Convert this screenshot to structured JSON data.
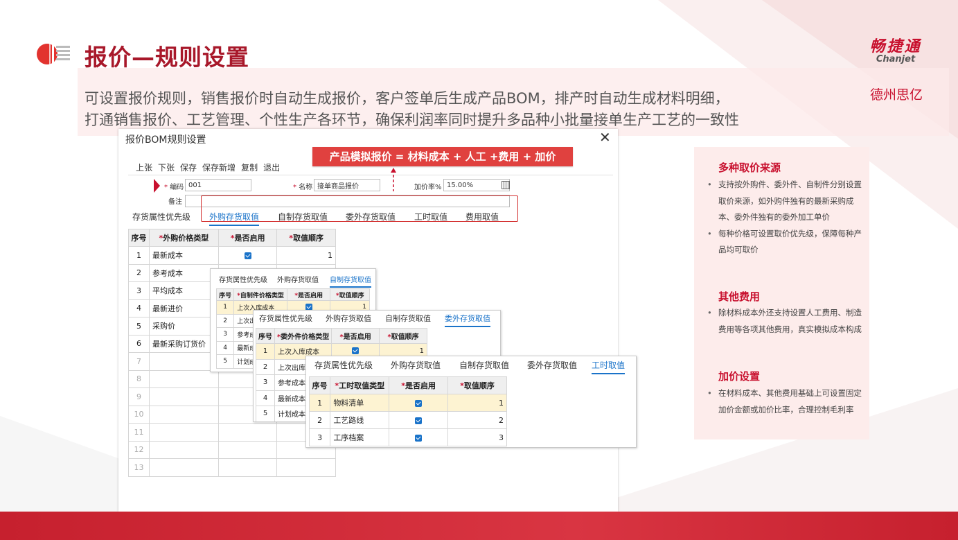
{
  "slide": {
    "title": "报价—规则设置",
    "brand_cn": "畅捷通",
    "brand_en": "Chanjet",
    "company": "德州思亿",
    "desc_line1": "可设置报价规则，销售报价时自动生成报价，客户签单后生成产品BOM，排产时自动生成材料明细，",
    "desc_line2": "打通销售报价、工艺管理、个性生产各环节，确保利润率同时提升多品种小批量接单生产工艺的一致性",
    "formula": "产品模拟报价 = 材料成本 + 人工 +费用 + 加价"
  },
  "window": {
    "title": "报价BOM规则设置",
    "close": "✕",
    "toolbar": [
      "上张",
      "下张",
      "保存",
      "保存新增",
      "复制",
      "退出"
    ],
    "form": {
      "code_label": "编码",
      "code_value": "001",
      "name_label": "名称",
      "name_value": "接单商品报价",
      "markup_label": "加价率%",
      "markup_value": "15.00%",
      "remark_label": "备注",
      "remark_value": ""
    },
    "tabs": [
      "存货属性优先级",
      "外购存货取值",
      "自制存货取值",
      "委外存货取值",
      "工时取值",
      "费用取值"
    ],
    "active_tab": "外购存货取值",
    "table": {
      "headers": [
        "序号",
        "外购价格类型",
        "是否启用",
        "取值顺序"
      ],
      "rows": [
        [
          "1",
          "最新成本",
          true,
          "1"
        ],
        [
          "2",
          "参考成本",
          null,
          ""
        ],
        [
          "3",
          "平均成本",
          null,
          ""
        ],
        [
          "4",
          "最新进价",
          null,
          ""
        ],
        [
          "5",
          "采购价",
          null,
          ""
        ],
        [
          "6",
          "最新采购订货价",
          null,
          ""
        ],
        [
          "7",
          "",
          null,
          ""
        ],
        [
          "8",
          "",
          null,
          ""
        ],
        [
          "9",
          "",
          null,
          ""
        ],
        [
          "10",
          "",
          null,
          ""
        ],
        [
          "11",
          "",
          null,
          ""
        ],
        [
          "12",
          "",
          null,
          ""
        ],
        [
          "13",
          "",
          null,
          ""
        ]
      ]
    }
  },
  "popup1": {
    "tabs": [
      "存货属性优先级",
      "外购存货取值",
      "自制存货取值"
    ],
    "active_tab": "自制存货取值",
    "headers": [
      "序号",
      "自制件价格类型",
      "是否启用",
      "取值顺序"
    ],
    "rows": [
      [
        "1",
        "上次入库成本",
        true,
        "1"
      ],
      [
        "2",
        "上次出库",
        null,
        ""
      ],
      [
        "3",
        "参考成本",
        null,
        ""
      ],
      [
        "4",
        "最新成本",
        null,
        ""
      ],
      [
        "5",
        "计划成本",
        null,
        ""
      ]
    ]
  },
  "popup2": {
    "tabs": [
      "存货属性优先级",
      "外购存货取值",
      "自制存货取值",
      "委外存货取值"
    ],
    "active_tab": "委外存货取值",
    "headers": [
      "序号",
      "委外件价格类型",
      "是否启用",
      "取值顺序"
    ],
    "rows": [
      [
        "1",
        "上次入库成本",
        true,
        "1"
      ],
      [
        "2",
        "上次出库成",
        null,
        ""
      ],
      [
        "3",
        "参考成本",
        null,
        ""
      ],
      [
        "4",
        "最新成本",
        null,
        ""
      ],
      [
        "5",
        "计划成本",
        null,
        ""
      ]
    ]
  },
  "popup3": {
    "tabs": [
      "存货属性优先级",
      "外购存货取值",
      "自制存货取值",
      "委外存货取值",
      "工时取值"
    ],
    "active_tab": "工时取值",
    "headers": [
      "序号",
      "工时取值类型",
      "是否启用",
      "取值顺序"
    ],
    "rows": [
      [
        "1",
        "物料清单",
        true,
        "1"
      ],
      [
        "2",
        "工艺路线",
        true,
        "2"
      ],
      [
        "3",
        "工序档案",
        true,
        "3"
      ]
    ]
  },
  "panel": {
    "sections": [
      {
        "title": "多种取价来源",
        "items": [
          "支持按外购件、委外件、自制件分别设置取价来源，如外购件独有的最新采购成本、委外件独有的委外加工单价",
          "每种价格可设置取价优先级，保障每种产品均可取价"
        ]
      },
      {
        "title": "其他费用",
        "items": [
          "除材料成本外还支持设置人工费用、制造费用等各项其他费用，真实模拟成本构成"
        ]
      },
      {
        "title": "加价设置",
        "items": [
          "在材料成本、其他费用基础上可设置固定加价金额或加价比率，合理控制毛利率"
        ]
      }
    ]
  },
  "colors": {
    "brand_red": "#c8102e",
    "accent_blue": "#1a73c9",
    "highlight": "#fdf3d2"
  }
}
